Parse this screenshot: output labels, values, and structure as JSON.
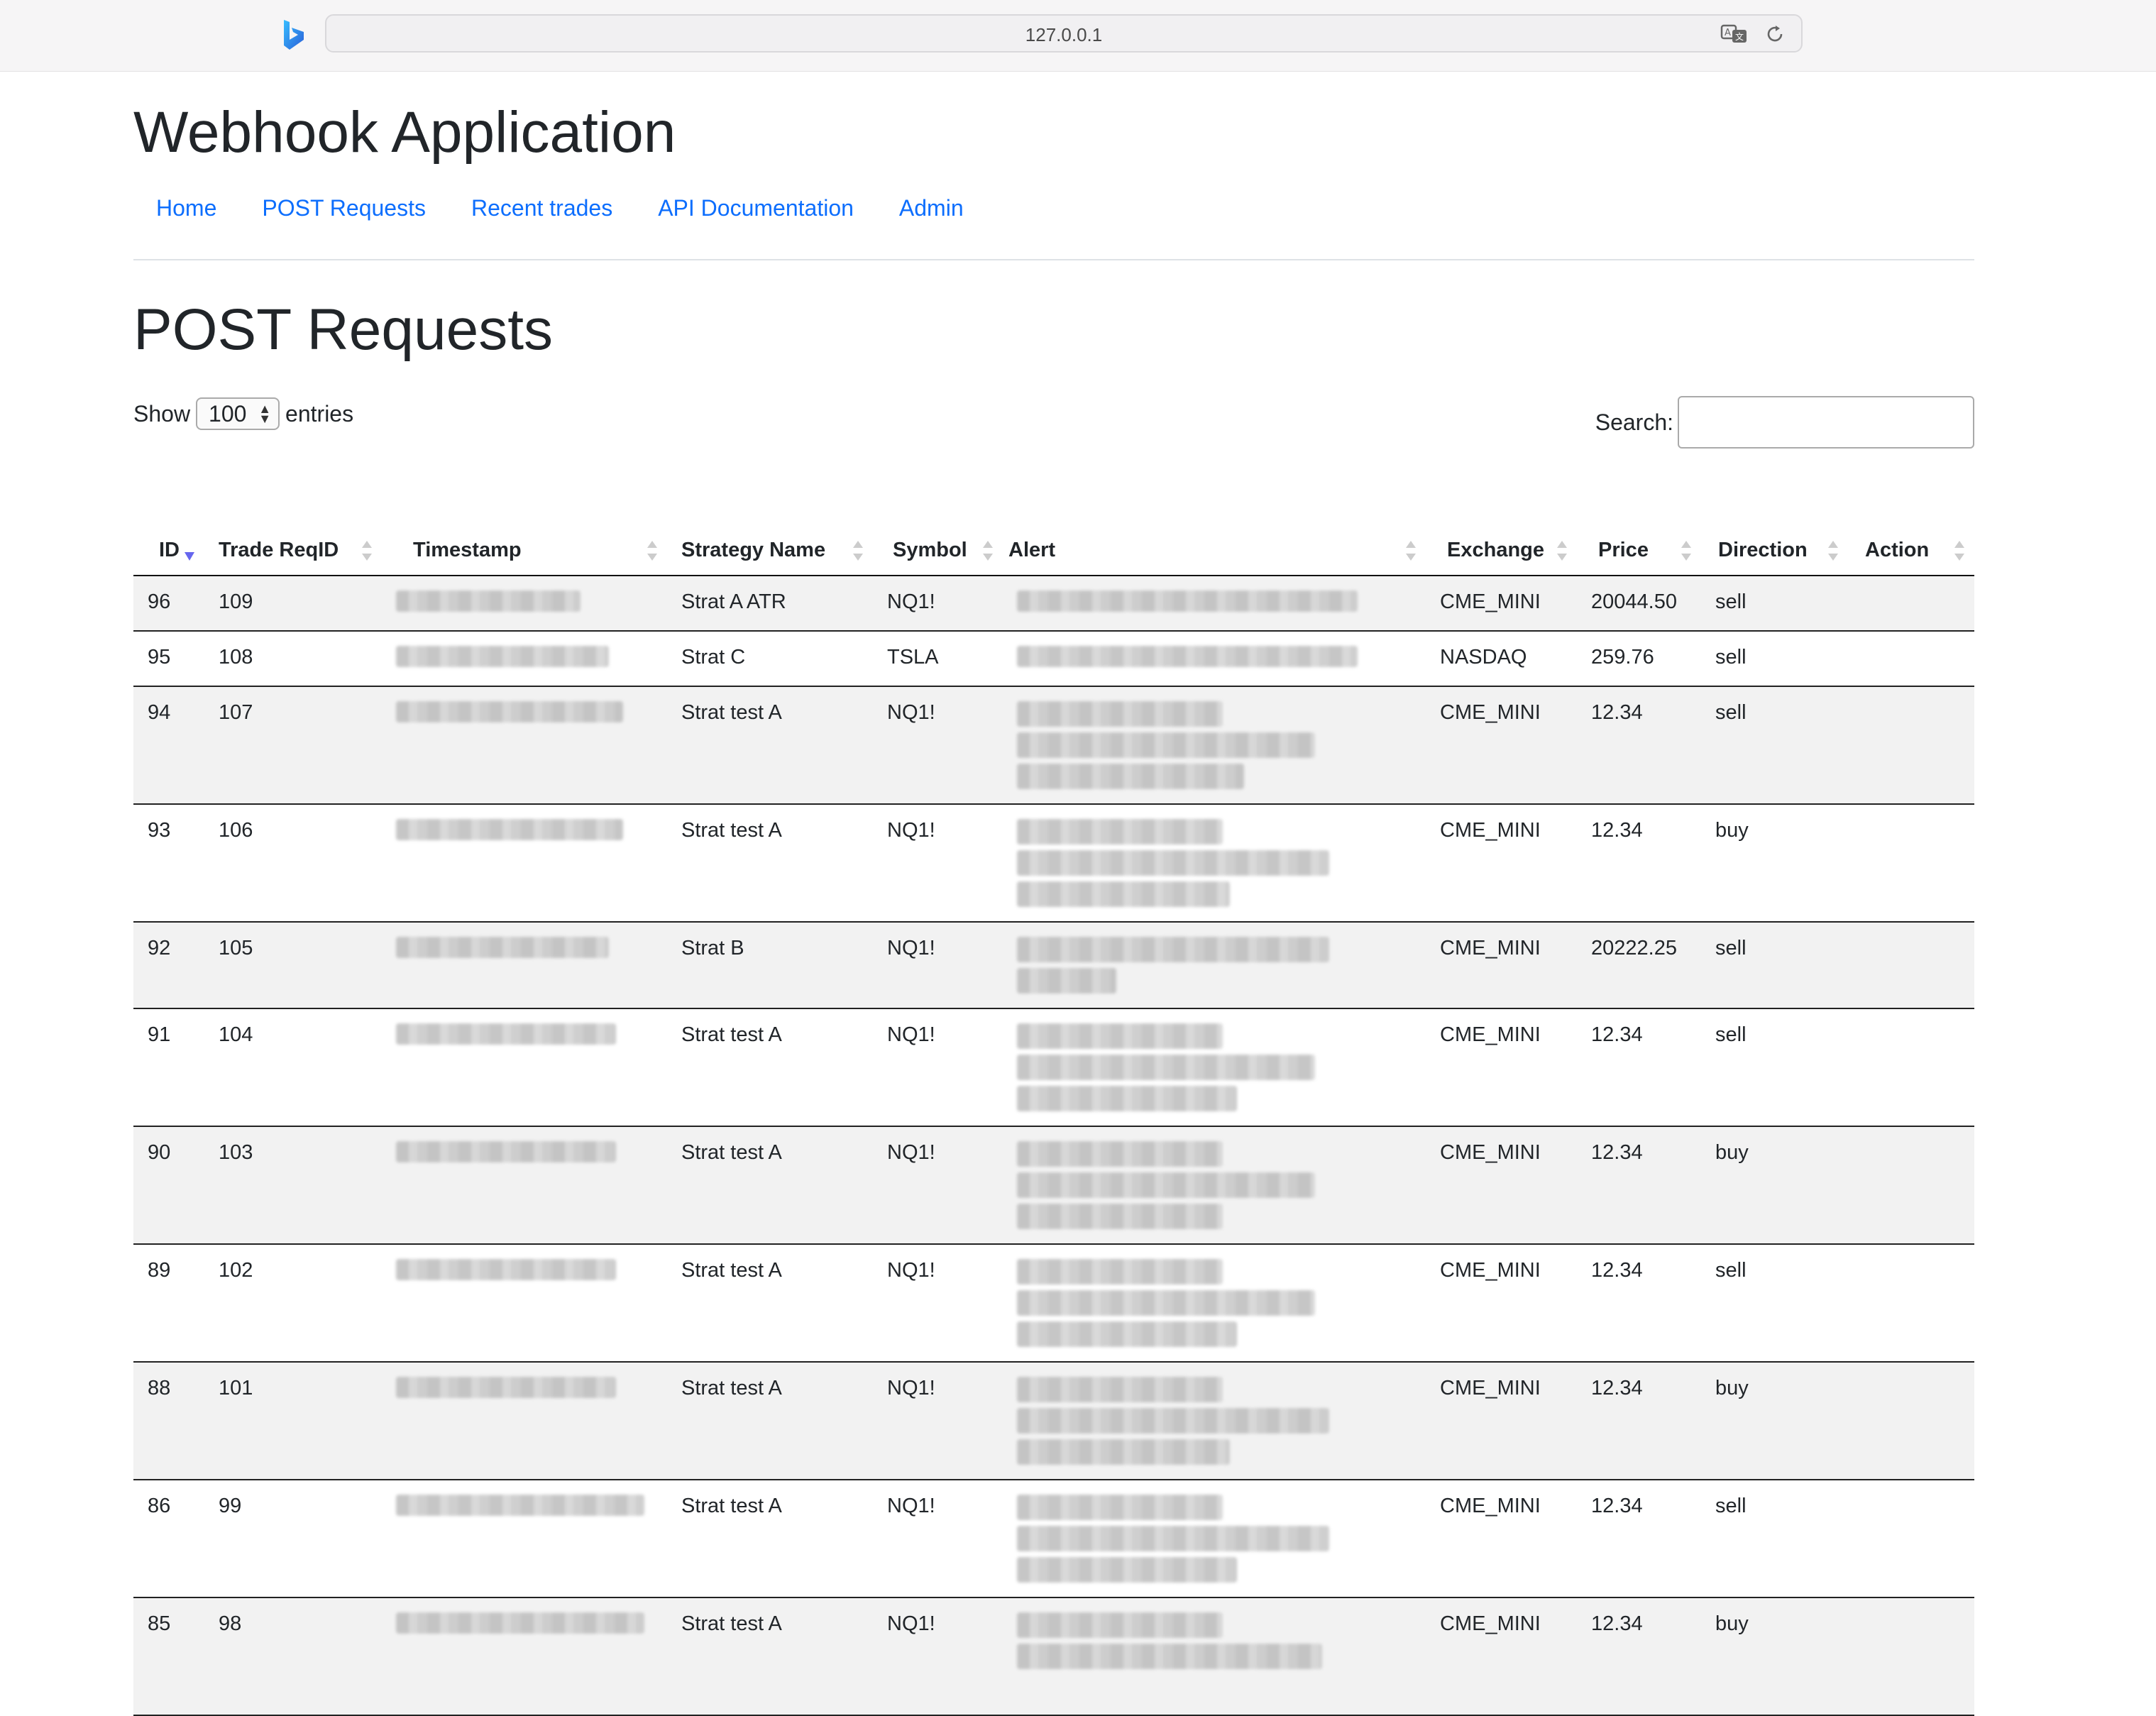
{
  "browser": {
    "url": "127.0.0.1",
    "icons": [
      "bing-icon",
      "translate-icon",
      "reload-icon"
    ]
  },
  "app": {
    "title": "Webhook Application",
    "nav": [
      "Home",
      "POST Requests",
      "Recent trades",
      "API Documentation",
      "Admin"
    ]
  },
  "page": {
    "title": "POST Requests",
    "show_label": "Show",
    "entries_value": "100",
    "entries_label": "entries",
    "search_label": "Search:",
    "search_value": ""
  },
  "table": {
    "columns": [
      "ID",
      "Trade ReqID",
      "Timestamp",
      "Strategy Name",
      "Symbol",
      "Alert",
      "Exchange",
      "Price",
      "Direction",
      "Action"
    ],
    "sorted_column": "ID",
    "sort_order": "descending",
    "rows": [
      {
        "id": "96",
        "req": "109",
        "strategy": "Strat A ATR",
        "symbol": "NQ1!",
        "exchange": "CME_MINI",
        "price": "20044.50",
        "direction": "sell",
        "action": "",
        "timestamp_redacted": true,
        "alert_redacted": true
      },
      {
        "id": "95",
        "req": "108",
        "strategy": "Strat C",
        "symbol": "TSLA",
        "exchange": "NASDAQ",
        "price": "259.76",
        "direction": "sell",
        "action": "",
        "timestamp_redacted": true,
        "alert_redacted": true
      },
      {
        "id": "94",
        "req": "107",
        "strategy": "Strat test A",
        "symbol": "NQ1!",
        "exchange": "CME_MINI",
        "price": "12.34",
        "direction": "sell",
        "action": "",
        "timestamp_redacted": true,
        "alert_redacted": true
      },
      {
        "id": "93",
        "req": "106",
        "strategy": "Strat test A",
        "symbol": "NQ1!",
        "exchange": "CME_MINI",
        "price": "12.34",
        "direction": "buy",
        "action": "",
        "timestamp_redacted": true,
        "alert_redacted": true
      },
      {
        "id": "92",
        "req": "105",
        "strategy": "Strat B",
        "symbol": "NQ1!",
        "exchange": "CME_MINI",
        "price": "20222.25",
        "direction": "sell",
        "action": "",
        "timestamp_redacted": true,
        "alert_redacted": true
      },
      {
        "id": "91",
        "req": "104",
        "strategy": "Strat test A",
        "symbol": "NQ1!",
        "exchange": "CME_MINI",
        "price": "12.34",
        "direction": "sell",
        "action": "",
        "timestamp_redacted": true,
        "alert_redacted": true
      },
      {
        "id": "90",
        "req": "103",
        "strategy": "Strat test A",
        "symbol": "NQ1!",
        "exchange": "CME_MINI",
        "price": "12.34",
        "direction": "buy",
        "action": "",
        "timestamp_redacted": true,
        "alert_redacted": true
      },
      {
        "id": "89",
        "req": "102",
        "strategy": "Strat test A",
        "symbol": "NQ1!",
        "exchange": "CME_MINI",
        "price": "12.34",
        "direction": "sell",
        "action": "",
        "timestamp_redacted": true,
        "alert_redacted": true
      },
      {
        "id": "88",
        "req": "101",
        "strategy": "Strat test A",
        "symbol": "NQ1!",
        "exchange": "CME_MINI",
        "price": "12.34",
        "direction": "buy",
        "action": "",
        "timestamp_redacted": true,
        "alert_redacted": true
      },
      {
        "id": "86",
        "req": "99",
        "strategy": "Strat test A",
        "symbol": "NQ1!",
        "exchange": "CME_MINI",
        "price": "12.34",
        "direction": "sell",
        "action": "",
        "timestamp_redacted": true,
        "alert_redacted": true
      },
      {
        "id": "85",
        "req": "98",
        "strategy": "Strat test A",
        "symbol": "NQ1!",
        "exchange": "CME_MINI",
        "price": "12.34",
        "direction": "buy",
        "action": "",
        "timestamp_redacted": true,
        "alert_redacted": true
      }
    ]
  },
  "colors": {
    "link": "#0d6efd",
    "stripe": "#f2f2f2",
    "sort_active": "#6666ee"
  }
}
